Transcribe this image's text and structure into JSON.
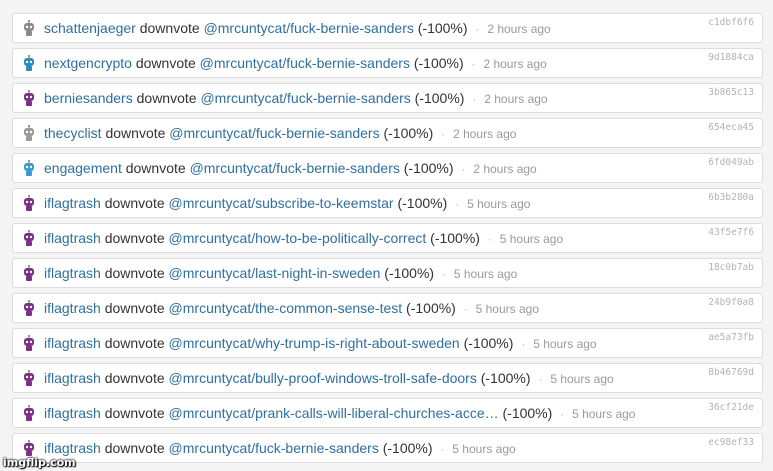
{
  "colors": {
    "link": "#2f6f9f",
    "text": "#333333",
    "muted": "#9a9a9a",
    "hash": "#b3b3b3"
  },
  "vote_action": "downvote",
  "rows": [
    {
      "user": "schattenjaeger",
      "avatar_color": "#8a8a8a",
      "link": "@mrcuntycat/fuck-bernie-sanders",
      "pct": "(-100%)",
      "time": "2 hours ago",
      "hash": "c1dbf6f6"
    },
    {
      "user": "nextgencrypto",
      "avatar_color": "#2e8ab8",
      "link": "@mrcuntycat/fuck-bernie-sanders",
      "pct": "(-100%)",
      "time": "2 hours ago",
      "hash": "9d1884ca"
    },
    {
      "user": "berniesanders",
      "avatar_color": "#7d2f86",
      "link": "@mrcuntycat/fuck-bernie-sanders",
      "pct": "(-100%)",
      "time": "2 hours ago",
      "hash": "3b865c13"
    },
    {
      "user": "thecyclist",
      "avatar_color": "#9a9a9a",
      "link": "@mrcuntycat/fuck-bernie-sanders",
      "pct": "(-100%)",
      "time": "2 hours ago",
      "hash": "654eca45"
    },
    {
      "user": "engagement",
      "avatar_color": "#3a9ad6",
      "link": "@mrcuntycat/fuck-bernie-sanders",
      "pct": "(-100%)",
      "time": "2 hours ago",
      "hash": "6fd049ab"
    },
    {
      "user": "iflagtrash",
      "avatar_color": "#7d2f86",
      "link": "@mrcuntycat/subscribe-to-keemstar",
      "pct": "(-100%)",
      "time": "5 hours ago",
      "hash": "6b3b280a"
    },
    {
      "user": "iflagtrash",
      "avatar_color": "#7d2f86",
      "link": "@mrcuntycat/how-to-be-politically-correct",
      "pct": "(-100%)",
      "time": "5 hours ago",
      "hash": "43f5e7f6"
    },
    {
      "user": "iflagtrash",
      "avatar_color": "#7d2f86",
      "link": "@mrcuntycat/last-night-in-sweden",
      "pct": "(-100%)",
      "time": "5 hours ago",
      "hash": "18c0b7ab"
    },
    {
      "user": "iflagtrash",
      "avatar_color": "#7d2f86",
      "link": "@mrcuntycat/the-common-sense-test",
      "pct": "(-100%)",
      "time": "5 hours ago",
      "hash": "24b9f0a8"
    },
    {
      "user": "iflagtrash",
      "avatar_color": "#7d2f86",
      "link": "@mrcuntycat/why-trump-is-right-about-sweden",
      "pct": "(-100%)",
      "time": "5 hours ago",
      "hash": "ae5a73fb"
    },
    {
      "user": "iflagtrash",
      "avatar_color": "#7d2f86",
      "link": "@mrcuntycat/bully-proof-windows-troll-safe-doors",
      "pct": "(-100%)",
      "time": "5 hours ago",
      "hash": "8b46769d"
    },
    {
      "user": "iflagtrash",
      "avatar_color": "#7d2f86",
      "link": "@mrcuntycat/prank-calls-will-liberal-churches-acce…",
      "pct": "(-100%)",
      "time": "5 hours ago",
      "hash": "36cf21de"
    },
    {
      "user": "iflagtrash",
      "avatar_color": "#7d2f86",
      "link": "@mrcuntycat/fuck-bernie-sanders",
      "pct": "(-100%)",
      "time": "5 hours ago",
      "hash": "ec98ef33"
    }
  ],
  "watermark": "imgflip.com"
}
